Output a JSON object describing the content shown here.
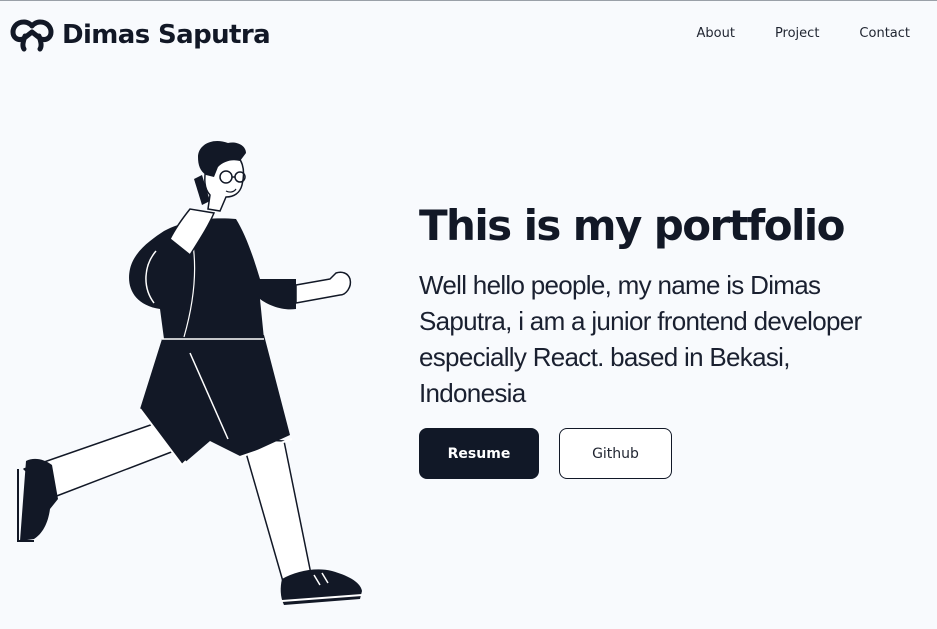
{
  "header": {
    "brand": "Dimas Saputra",
    "logo_icon": "infinity-loop-icon",
    "nav": [
      {
        "label": "About"
      },
      {
        "label": "Project"
      },
      {
        "label": "Contact"
      }
    ]
  },
  "hero": {
    "title": "This is my portfolio",
    "description": "Well hello people, my name is Dimas Saputra, i am a junior frontend developer especially React. based in Bekasi, Indonesia",
    "illustration": "running-man-on-phone-illustration",
    "buttons": {
      "primary": "Resume",
      "secondary": "Github"
    }
  },
  "colors": {
    "background": "#f8fafd",
    "primary": "#111827",
    "text": "#121826"
  }
}
